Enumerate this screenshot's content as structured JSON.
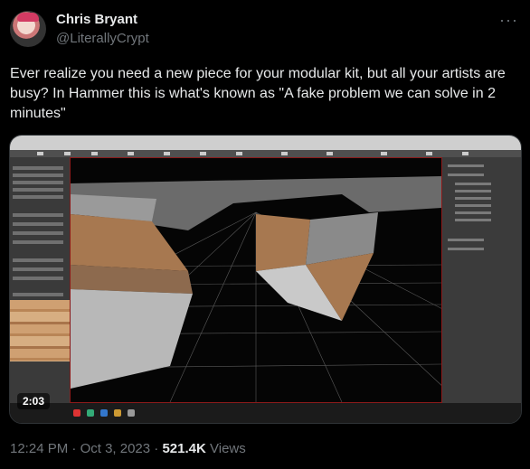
{
  "author": {
    "name": "Chris Bryant",
    "handle": "@LiterallyCrypt"
  },
  "tweet": {
    "text": "Ever realize you need a new piece for your modular kit, but all your artists are busy? In Hammer this is what's known as \"A fake problem we can solve in 2 minutes\""
  },
  "video": {
    "duration": "2:03"
  },
  "meta": {
    "time": "12:24 PM",
    "date": "Oct 3, 2023",
    "views_count": "521.4K",
    "views_label": "Views",
    "sep": "·"
  },
  "icons": {
    "more": "more-horizontal-icon"
  },
  "colors": {
    "background": "#000000",
    "text": "#e7e9ea",
    "muted": "#71767b",
    "viewport_border": "#8b1a1a"
  }
}
